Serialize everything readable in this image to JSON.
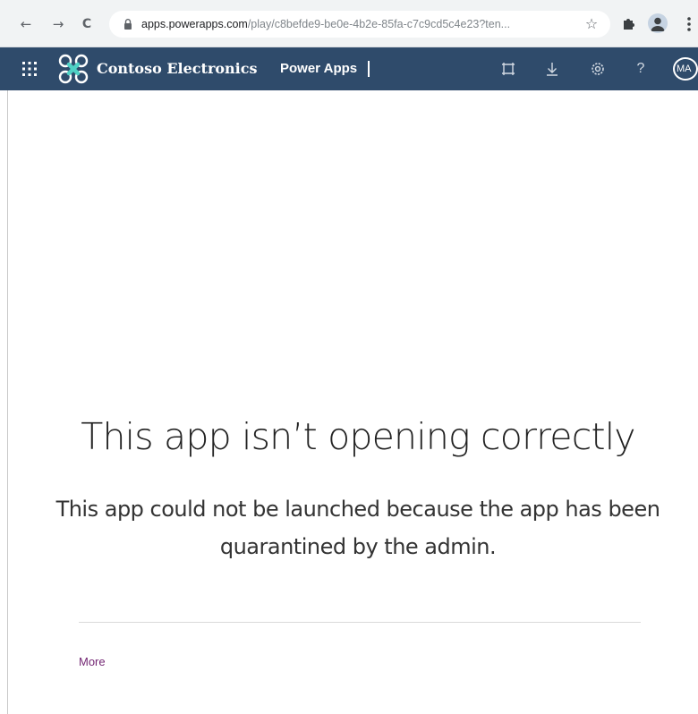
{
  "browser": {
    "back_glyph": "←",
    "forward_glyph": "→",
    "reload_glyph": "C",
    "url_domain": "apps.powerapps.com",
    "url_path": "/play/c8befde9-be0e-4b2e-85fa-c7c9cd5c4e23?ten...",
    "icons": [
      "back-arrow-icon",
      "forward-arrow-icon",
      "reload-icon",
      "lock-icon",
      "star-icon",
      "puzzle-extension-icon",
      "profile-icon",
      "more-vertical-icon"
    ]
  },
  "app_header": {
    "org_name": "Contoso Electronics",
    "product_name": "Power Apps",
    "avatar_initials": "MA",
    "background_color": "#2f4b6b",
    "icons": [
      "waffle-icon",
      "contoso-logo-icon",
      "fit-to-window-icon",
      "download-icon",
      "settings-icon",
      "help-icon"
    ]
  },
  "error": {
    "title": "This app isn’t opening correctly",
    "message": "This app could not be launched because the app has been quarantined by the admin.",
    "more_link": "More",
    "link_color": "#742774"
  }
}
